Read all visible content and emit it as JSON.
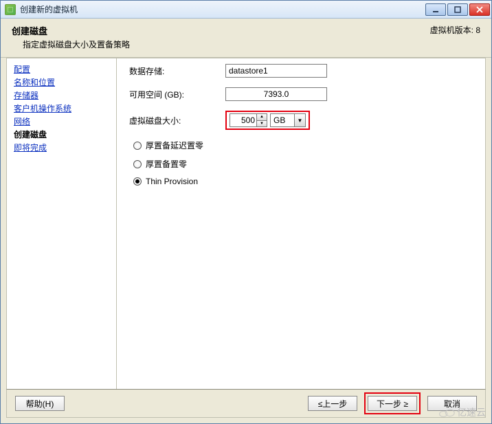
{
  "window": {
    "title": "创建新的虚拟机"
  },
  "header": {
    "title": "创建磁盘",
    "subtitle": "指定虚拟磁盘大小及置备策略",
    "version_label": "虚拟机版本: 8"
  },
  "sidebar": {
    "items": [
      {
        "label": "配置"
      },
      {
        "label": "名称和位置"
      },
      {
        "label": "存储器"
      },
      {
        "label": "客户机操作系统"
      },
      {
        "label": "网络"
      },
      {
        "label": "创建磁盘"
      },
      {
        "label": "即将完成"
      }
    ],
    "current_index": 5
  },
  "content": {
    "datastore_label": "数据存储:",
    "datastore_value": "datastore1",
    "free_space_label": "可用空间 (GB):",
    "free_space_value": "7393.0",
    "disk_size_label": "虚拟磁盘大小:",
    "disk_size_value": "500",
    "disk_size_unit": "GB",
    "provision_options": [
      {
        "label": "厚置备延迟置零",
        "selected": false
      },
      {
        "label": "厚置备置零",
        "selected": false
      },
      {
        "label": "Thin Provision",
        "selected": true
      }
    ]
  },
  "footer": {
    "help_label": "帮助(H)",
    "back_label": "≤上一步",
    "next_label": "下一步 ≥",
    "cancel_label": "取消"
  },
  "watermark": "亿速云"
}
